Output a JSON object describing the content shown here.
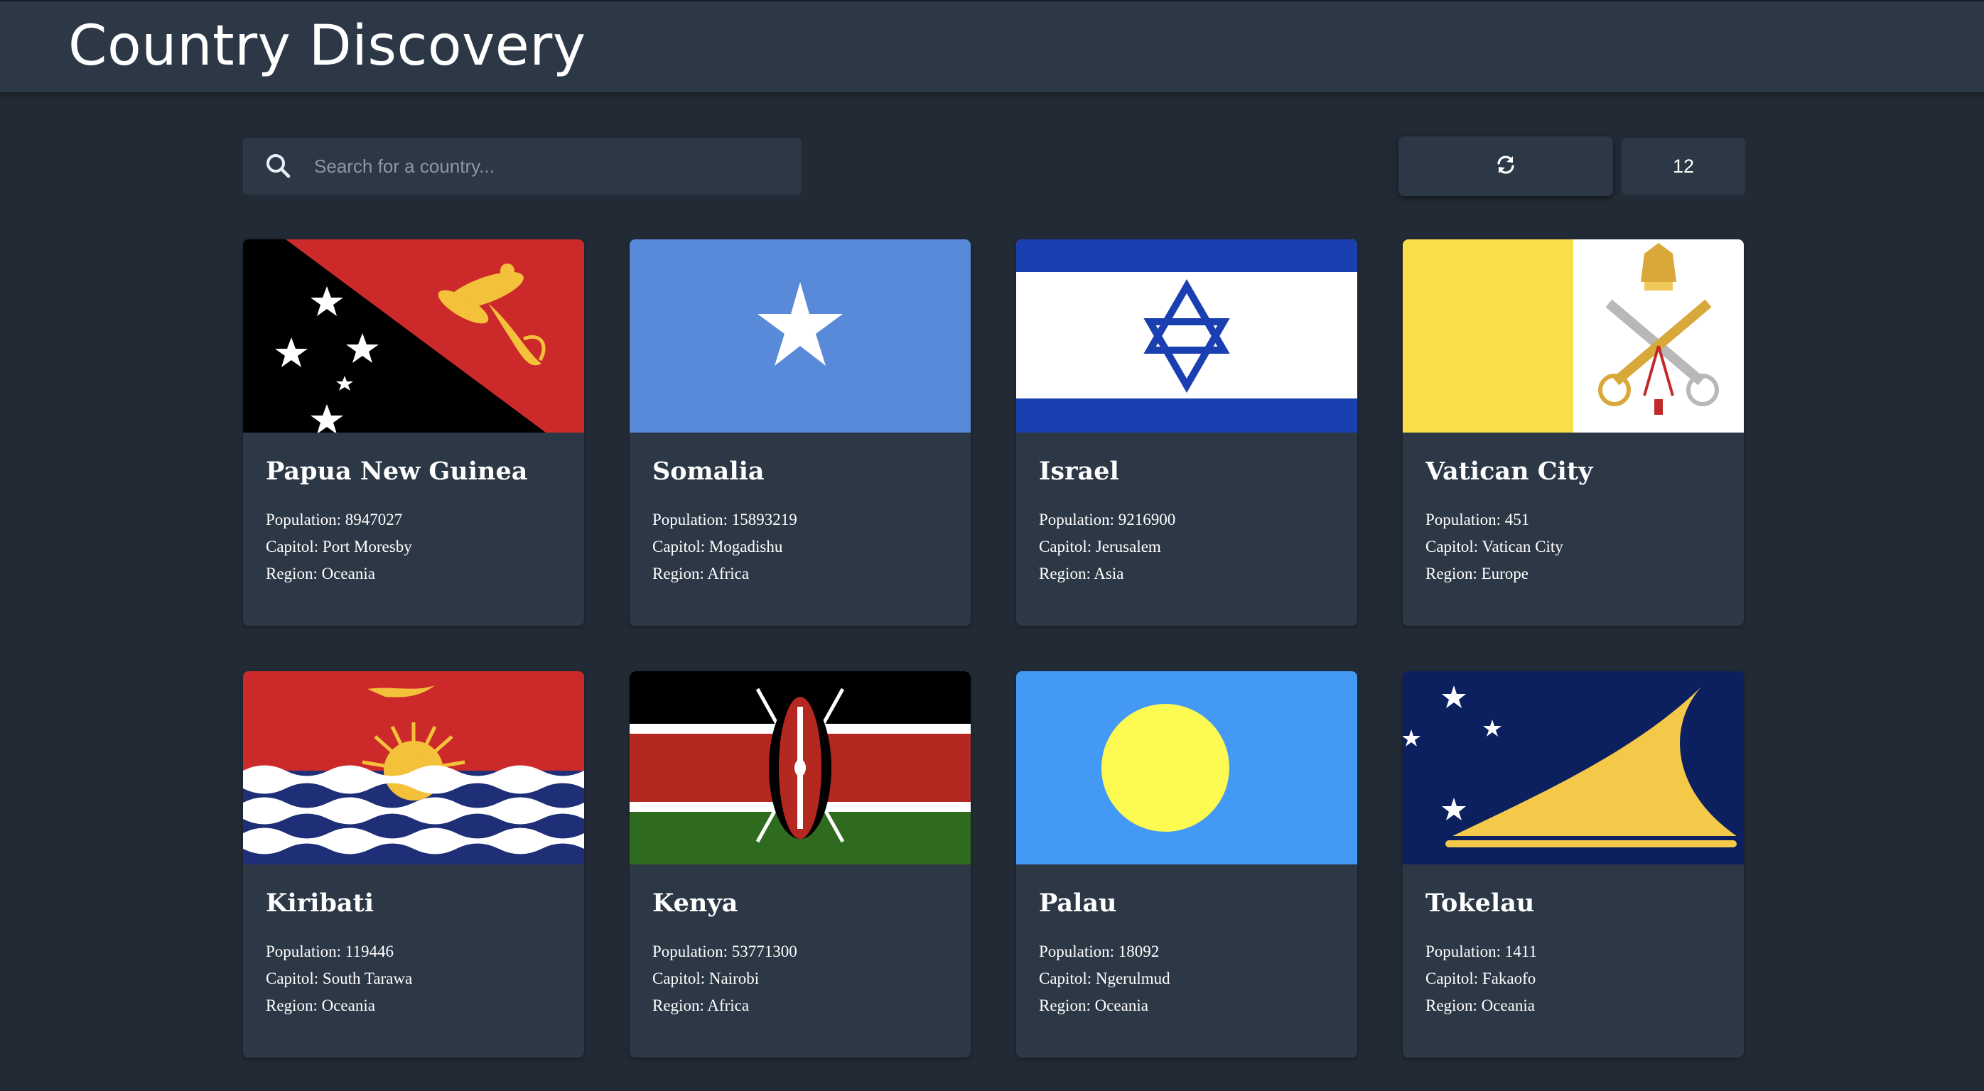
{
  "app": {
    "title": "Country Discovery",
    "bg_color": "#222a35",
    "panel_color": "#2d3846"
  },
  "search": {
    "placeholder": "Search for a country...",
    "value": "",
    "icon": "search-icon"
  },
  "toolbar": {
    "refresh_icon": "refresh-icon",
    "count": "12"
  },
  "countries": [
    {
      "name": "Papua New Guinea",
      "population": "Population: 8947027",
      "capital": "Capitol: Port Moresby",
      "region": "Region: Oceania"
    },
    {
      "name": "Somalia",
      "population": "Population: 15893219",
      "capital": "Capitol: Mogadishu",
      "region": "Region: Africa"
    },
    {
      "name": "Israel",
      "population": "Population: 9216900",
      "capital": "Capitol: Jerusalem",
      "region": "Region: Asia"
    },
    {
      "name": "Vatican City",
      "population": "Population: 451",
      "capital": "Capitol: Vatican City",
      "region": "Region: Europe"
    },
    {
      "name": "Kiribati",
      "population": "Population: 119446",
      "capital": "Capitol: South Tarawa",
      "region": "Region: Oceania"
    },
    {
      "name": "Kenya",
      "population": "Population: 53771300",
      "capital": "Capitol: Nairobi",
      "region": "Region: Africa"
    },
    {
      "name": "Palau",
      "population": "Population: 18092",
      "capital": "Capitol: Ngerulmud",
      "region": "Region: Oceania"
    },
    {
      "name": "Tokelau",
      "population": "Population: 1411",
      "capital": "Capitol: Fakaofo",
      "region": "Region: Oceania"
    }
  ]
}
